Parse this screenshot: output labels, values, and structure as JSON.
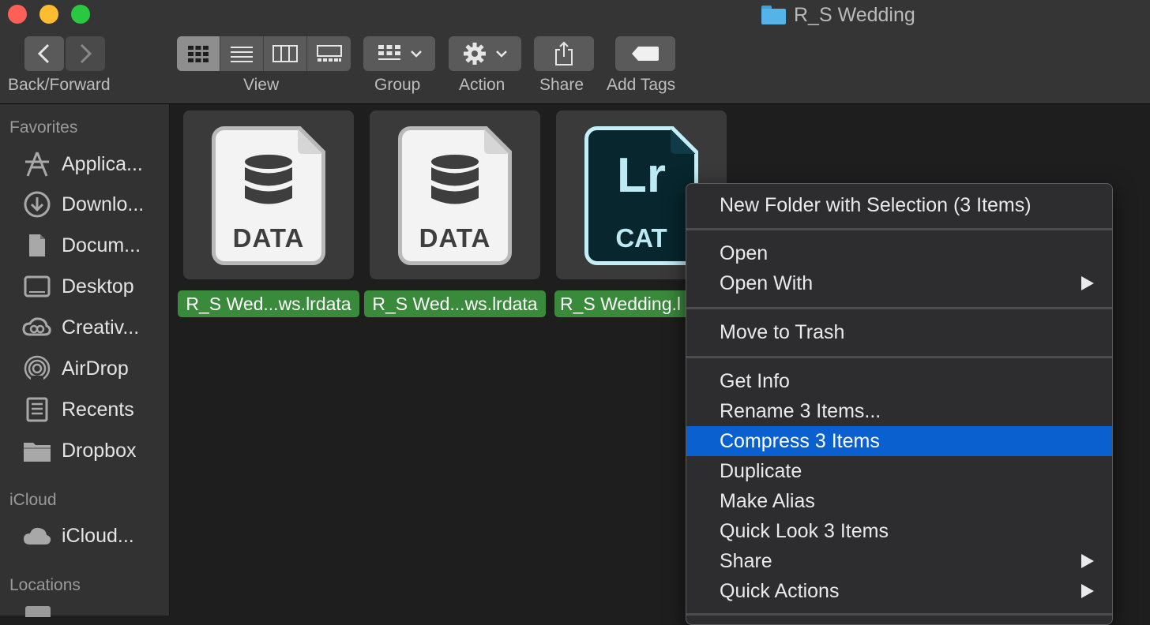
{
  "window": {
    "title": "R_S Wedding"
  },
  "toolbar": {
    "back_forward_label": "Back/Forward",
    "view_label": "View",
    "group_label": "Group",
    "action_label": "Action",
    "share_label": "Share",
    "add_tags_label": "Add Tags"
  },
  "sidebar": {
    "favorites_heading": "Favorites",
    "favorites": [
      {
        "label": "Applica...",
        "icon": "applications-icon"
      },
      {
        "label": "Downlo...",
        "icon": "downloads-icon"
      },
      {
        "label": "Docum...",
        "icon": "documents-icon"
      },
      {
        "label": "Desktop",
        "icon": "desktop-icon"
      },
      {
        "label": "Creativ...",
        "icon": "creative-cloud-icon"
      },
      {
        "label": "AirDrop",
        "icon": "airdrop-icon"
      },
      {
        "label": "Recents",
        "icon": "recents-icon"
      },
      {
        "label": "Dropbox",
        "icon": "folder-icon"
      }
    ],
    "icloud_heading": "iCloud",
    "icloud": [
      {
        "label": "iCloud...",
        "icon": "cloud-icon"
      }
    ],
    "locations_heading": "Locations"
  },
  "files": [
    {
      "name": "R_S Wed...ws.lrdata",
      "badge": "DATA"
    },
    {
      "name": "R_S Wed...ws.lrdata",
      "badge": "DATA"
    },
    {
      "name": "R_S Wedding.l",
      "badge": "CAT",
      "mark": "Lr"
    }
  ],
  "context_menu": {
    "items": [
      "New Folder with Selection (3 Items)",
      "Open",
      "Open With",
      "Move to Trash",
      "Get Info",
      "Rename 3 Items...",
      "Compress 3 Items",
      "Duplicate",
      "Make Alias",
      "Quick Look 3 Items",
      "Share",
      "Quick Actions"
    ],
    "highlighted": "Compress 3 Items"
  },
  "colors": {
    "selection_green": "#3a8a3c",
    "menu_highlight": "#0b60cf",
    "folder_blue": "#54b4ea"
  }
}
